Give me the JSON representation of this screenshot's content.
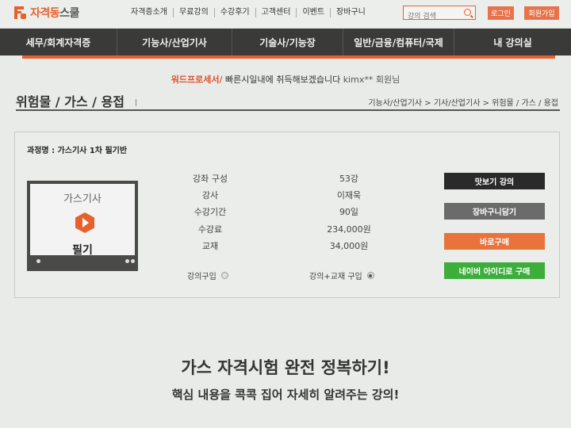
{
  "header": {
    "logo_text_main": "자격동",
    "logo_text_sub": "스쿨",
    "util_nav": [
      "자격증소개",
      "무료강의",
      "수강후기",
      "고객센터",
      "이벤트",
      "장바구니"
    ],
    "search_placeholder": "강의 검색",
    "login_label": "로그인",
    "join_label": "회원가입"
  },
  "main_nav": [
    "세무/회계자격증",
    "기능사/산업기사",
    "기술사/기능장",
    "일반/금융/컴퓨터/국제",
    "내 강의실"
  ],
  "ticker": {
    "highlight": "워드프로세서/",
    "message": "빠른시일내에 취득해보겠습니다",
    "user": "kimx** 회원님"
  },
  "page": {
    "title": "위험물 / 가스 / 용접",
    "breadcrumb": "기능사/산업기사 > 기사/산업기사 > 위험물 / 가스 / 용접"
  },
  "course": {
    "name": "과정명 : 가스기사 1차 필기반",
    "thumb_title": "가스기사",
    "thumb_sub": "필기",
    "details": [
      {
        "label": "강좌 구성",
        "value": "53강"
      },
      {
        "label": "강사",
        "value": "이재욱"
      },
      {
        "label": "수강기간",
        "value": "90일"
      },
      {
        "label": "수강료",
        "value": "234,000원"
      },
      {
        "label": "교재",
        "value": "34,000원"
      }
    ],
    "options": [
      {
        "label": "강의구입",
        "selected": false
      },
      {
        "label": "강의+교재 구입",
        "selected": true
      }
    ],
    "buttons": {
      "preview": "맛보기 강의",
      "cart": "장바구니담기",
      "buy": "바로구매",
      "naver": "네이버 아이디로 구매"
    }
  },
  "promo": {
    "headline": "가스 자격시험 완전 정복하기!",
    "subline": "핵심 내용을 콕콕 집어 자세히 알려주는 강의!"
  },
  "colors": {
    "accent": "#e8602c",
    "nav_bg": "#3a3a38",
    "naver_green": "#3dae3b"
  }
}
